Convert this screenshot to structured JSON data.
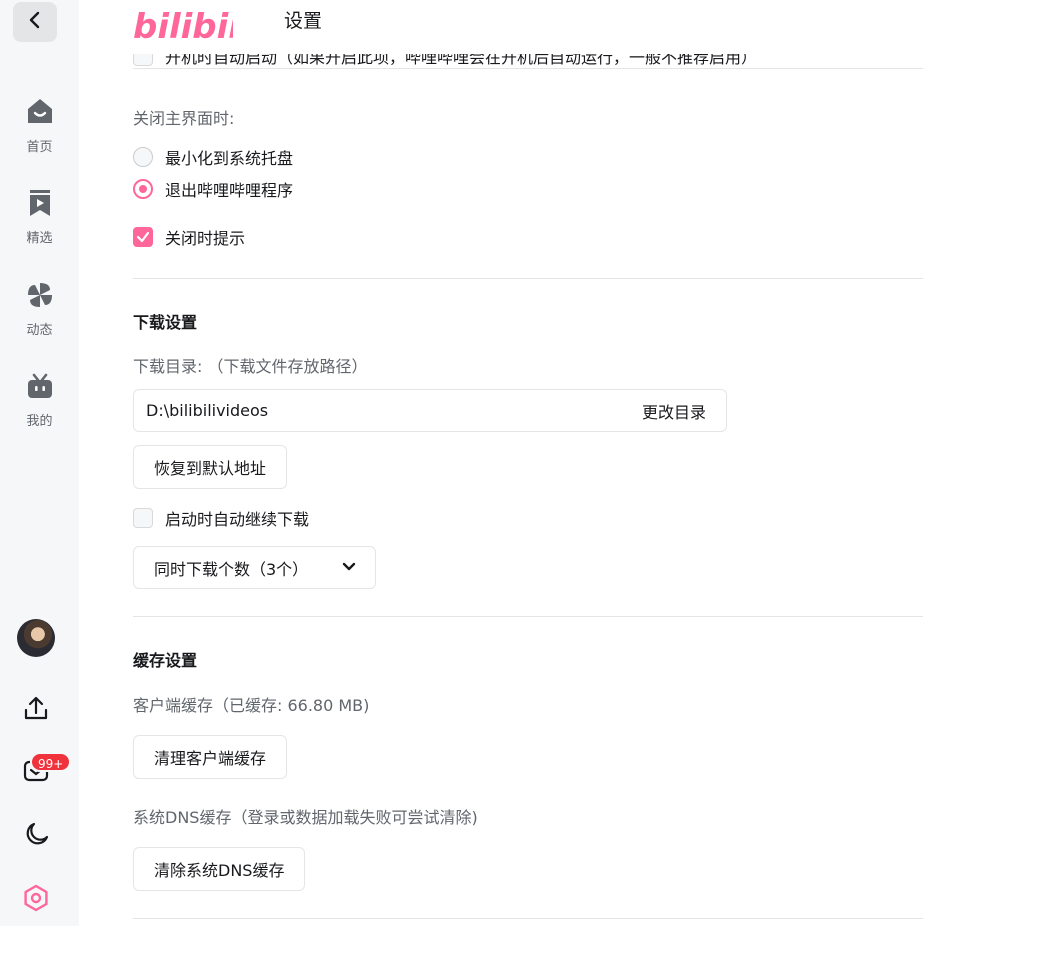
{
  "header": {
    "logo_text": "bilibili",
    "title": "设置"
  },
  "sidebar": {
    "items": [
      {
        "label": "首页"
      },
      {
        "label": "精选"
      },
      {
        "label": "动态"
      },
      {
        "label": "我的"
      }
    ],
    "messages_badge": "99+"
  },
  "partial_row": {
    "label": "开机时自动启动（如果开启此项，哔哩哔哩会在开机后自动运行，一般不推荐启用）"
  },
  "close_section": {
    "label": "关闭主界面时:",
    "options": [
      {
        "label": "最小化到系统托盘",
        "selected": false
      },
      {
        "label": "退出哔哩哔哩程序",
        "selected": true
      }
    ],
    "prompt_on_close": {
      "label": "关闭时提示",
      "checked": true
    }
  },
  "download": {
    "title": "下载设置",
    "dir_label": "下载目录: （下载文件存放路径）",
    "dir_value": "D:\\bilibilivideos",
    "change_dir_button": "更改目录",
    "restore_button": "恢复到默认地址",
    "auto_resume": {
      "label": "启动时自动继续下载",
      "checked": false
    },
    "concurrent_select": "同时下载个数（3个）"
  },
  "cache": {
    "title": "缓存设置",
    "client_label": "客户端缓存（已缓存: 66.80 MB)",
    "client_button": "清理客户端缓存",
    "dns_label": "系统DNS缓存（登录或数据加载失败可尝试清除)",
    "dns_button": "清除系统DNS缓存"
  },
  "colors": {
    "accent": "#ff6699",
    "sidebar_bg": "#f6f7f8",
    "badge": "#f0323c"
  }
}
